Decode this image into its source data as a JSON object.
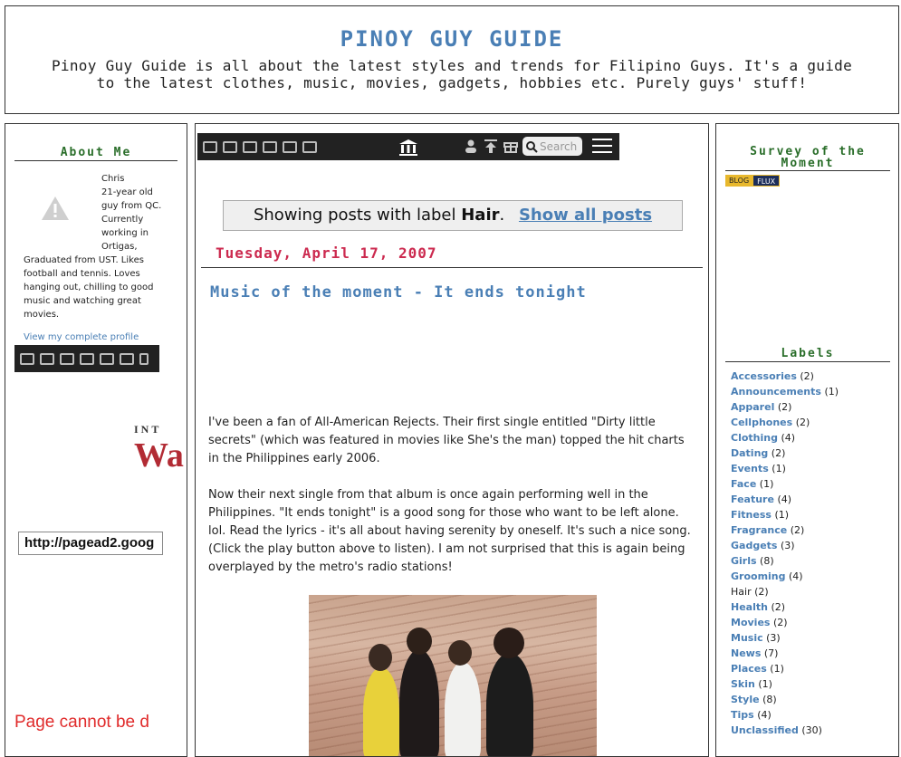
{
  "header": {
    "title": "PINOY GUY GUIDE",
    "description": "Pinoy Guy Guide is all about the latest styles and trends for Filipino Guys. It's a guide to the latest clothes, music, movies, gadgets, hobbies etc. Purely guys' stuff!"
  },
  "left": {
    "about_heading": "About Me",
    "profile_name": "Chris",
    "profile_line_1": "21-year old",
    "profile_line_2": "guy from QC.",
    "profile_line_3": "Currently",
    "profile_line_4": "working in",
    "profile_line_5": "Ortigas,",
    "profile_line_6": "Graduated from UST. Likes",
    "profile_line_7": "football and tennis. Loves",
    "profile_line_8": "hanging out, chilling to good",
    "profile_line_9": "music and watching great",
    "profile_line_10": "movies.",
    "profile_link": "View my complete profile",
    "ad_text": "INT",
    "ad_logo": "Wa",
    "url_value": "http://pagead2.goog",
    "error_text": "Page cannot be d"
  },
  "toolbar": {
    "search_placeholder": "Search",
    "icons": [
      "window-icon",
      "book-icon",
      "film-icon",
      "speaker-icon",
      "save-icon",
      "image-icon"
    ]
  },
  "main": {
    "notice_prefix": "Showing posts with label",
    "notice_label": "Hair",
    "notice_link": "Show all posts",
    "date": "Tuesday, April 17, 2007",
    "post_title": "Music of the moment - It ends tonight",
    "paragraph_1": "I've been a fan of All-American Rejects. Their first single entitled \"Dirty little secrets\" (which was featured in movies like She's the man) topped the hit charts in the Philippines early 2006.",
    "paragraph_2": "Now their next single from that album is once again performing well in the Philippines. \"It ends tonight\" is a good song for those who want to be left alone. lol. Read the lyrics - it's all about having serenity by oneself. It's such a nice song. (Click the play button above to listen). I am not surprised that this is again being overplayed by the metro's radio stations!"
  },
  "right": {
    "survey_heading_1": "Survey of the",
    "survey_heading_2": "Moment",
    "blogflux_a": "BLOG",
    "blogflux_b": "FLUX",
    "labels_heading": "Labels",
    "labels": [
      {
        "name": "Accessories",
        "count": "(2)"
      },
      {
        "name": "Announcements",
        "count": "(1)"
      },
      {
        "name": "Apparel",
        "count": "(2)"
      },
      {
        "name": "Cellphones",
        "count": "(2)"
      },
      {
        "name": "Clothing",
        "count": "(4)"
      },
      {
        "name": "Dating",
        "count": "(2)"
      },
      {
        "name": "Events",
        "count": "(1)"
      },
      {
        "name": "Face",
        "count": "(1)"
      },
      {
        "name": "Feature",
        "count": "(4)"
      },
      {
        "name": "Fitness",
        "count": "(1)"
      },
      {
        "name": "Fragrance",
        "count": "(2)"
      },
      {
        "name": "Gadgets",
        "count": "(3)"
      },
      {
        "name": "Girls",
        "count": "(8)"
      },
      {
        "name": "Grooming",
        "count": "(4)"
      },
      {
        "name": "Hair",
        "count": "(2)"
      },
      {
        "name": "Health",
        "count": "(2)"
      },
      {
        "name": "Movies",
        "count": "(2)"
      },
      {
        "name": "Music",
        "count": "(3)"
      },
      {
        "name": "News",
        "count": "(7)"
      },
      {
        "name": "Places",
        "count": "(1)"
      },
      {
        "name": "Skin",
        "count": "(1)"
      },
      {
        "name": "Style",
        "count": "(8)"
      },
      {
        "name": "Tips",
        "count": "(4)"
      },
      {
        "name": "Unclassified",
        "count": "(30)"
      }
    ]
  },
  "colors": {
    "title_blue": "#4a7fb5",
    "date_red": "#cc2a4f",
    "heading_green": "#2a6e2a",
    "error_red": "#e02b2b"
  }
}
